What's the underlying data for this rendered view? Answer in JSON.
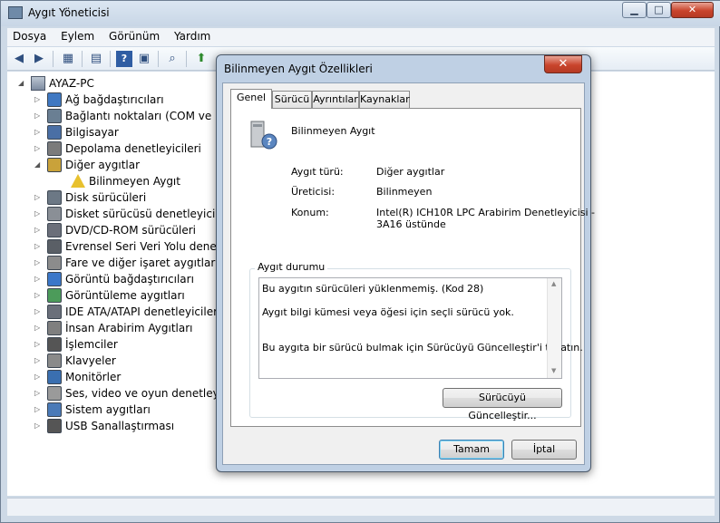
{
  "window": {
    "title": "Aygıt Yöneticisi",
    "controls": {
      "minimize": "▁",
      "maximize": "□",
      "close": "✕"
    }
  },
  "menubar": [
    "Dosya",
    "Eylem",
    "Görünüm",
    "Yardım"
  ],
  "toolbar": {
    "icons": [
      "back-arrow-icon",
      "forward-arrow-icon",
      "console-tree-icon",
      "properties-icon",
      "help-icon",
      "show-hidden-icon",
      "update-driver-icon"
    ]
  },
  "tree": {
    "root": "AYAZ-PC",
    "items": [
      {
        "label": "Ağ bağdaştırıcıları",
        "expander": "▷"
      },
      {
        "label": "Bağlantı noktaları (COM ve LPT",
        "expander": "▷"
      },
      {
        "label": "Bilgisayar",
        "expander": "▷"
      },
      {
        "label": "Depolama denetleyicileri",
        "expander": "▷"
      },
      {
        "label": "Diğer aygıtlar",
        "expander": "◢"
      },
      {
        "label": "Bilinmeyen Aygıt",
        "child": true
      },
      {
        "label": "Disk sürücüleri",
        "expander": "▷"
      },
      {
        "label": "Disket sürücüsü denetleyicileri",
        "expander": "▷"
      },
      {
        "label": "DVD/CD-ROM sürücüleri",
        "expander": "▷"
      },
      {
        "label": "Evrensel Seri Veri Yolu denetleyi",
        "expander": "▷"
      },
      {
        "label": "Fare ve diğer işaret aygıtları",
        "expander": "▷"
      },
      {
        "label": "Görüntü bağdaştırıcıları",
        "expander": "▷"
      },
      {
        "label": "Görüntüleme aygıtları",
        "expander": "▷"
      },
      {
        "label": "IDE ATA/ATAPI denetleyiciler",
        "expander": "▷"
      },
      {
        "label": "İnsan Arabirim Aygıtları",
        "expander": "▷"
      },
      {
        "label": "İşlemciler",
        "expander": "▷"
      },
      {
        "label": "Klavyeler",
        "expander": "▷"
      },
      {
        "label": "Monitörler",
        "expander": "▷"
      },
      {
        "label": "Ses, video ve oyun denetleyicile",
        "expander": "▷"
      },
      {
        "label": "Sistem aygıtları",
        "expander": "▷"
      },
      {
        "label": "USB Sanallaştırması",
        "expander": "▷"
      }
    ]
  },
  "dialog": {
    "title": "Bilinmeyen Aygıt Özellikleri",
    "close": "✕",
    "tabs": [
      "Genel",
      "Sürücü",
      "Ayrıntılar",
      "Kaynaklar"
    ],
    "device_name": "Bilinmeyen Aygıt",
    "props": [
      {
        "key": "Aygıt türü:",
        "value": "Diğer aygıtlar"
      },
      {
        "key": "Üreticisi:",
        "value": "Bilinmeyen"
      },
      {
        "key": "Konum:",
        "value": "Intel(R) ICH10R LPC Arabirim Denetleyicisi -",
        "value2": "3A16 üstünde"
      }
    ],
    "status_group": "Aygıt durumu",
    "status_lines": [
      "Bu aygıtın sürücüleri yüklenmemiş. (Kod 28)",
      "Aygıt bilgi kümesi veya öğesi için seçli sürücü yok.",
      "Bu aygıta bir sürücü bulmak için Sürücüyü Güncelleştir'i tıklatın."
    ],
    "update_button": "Sürücüyü Güncelleştir...",
    "ok_button": "Tamam",
    "cancel_button": "İptal"
  }
}
